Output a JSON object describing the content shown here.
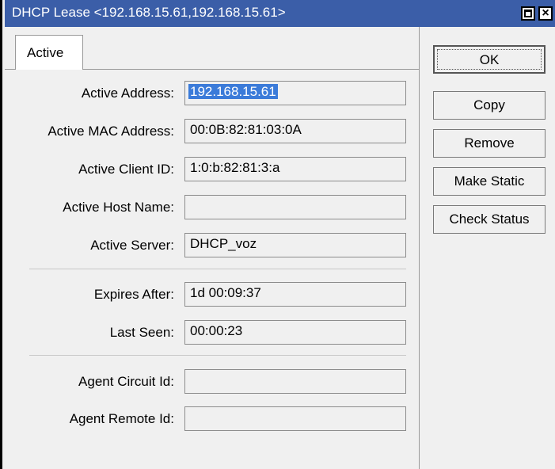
{
  "window": {
    "title": "DHCP Lease <192.168.15.61,192.168.15.61>",
    "close_glyph": "×"
  },
  "tabs": [
    {
      "label": "Active"
    }
  ],
  "fields": {
    "active_address": {
      "label": "Active Address:",
      "value": "192.168.15.61"
    },
    "active_mac_address": {
      "label": "Active MAC Address:",
      "value": "00:0B:82:81:03:0A"
    },
    "active_client_id": {
      "label": "Active Client ID:",
      "value": "1:0:b:82:81:3:a"
    },
    "active_host_name": {
      "label": "Active Host Name:",
      "value": ""
    },
    "active_server": {
      "label": "Active Server:",
      "value": "DHCP_voz"
    },
    "expires_after": {
      "label": "Expires After:",
      "value": "1d 00:09:37"
    },
    "last_seen": {
      "label": "Last Seen:",
      "value": "00:00:23"
    },
    "agent_circuit_id": {
      "label": "Agent Circuit Id:",
      "value": ""
    },
    "agent_remote_id": {
      "label": "Agent Remote Id:",
      "value": ""
    }
  },
  "buttons": {
    "ok": "OK",
    "copy": "Copy",
    "remove": "Remove",
    "make_static": "Make Static",
    "check_status": "Check Status"
  },
  "colors": {
    "titlebar": "#3b5ea8",
    "selection": "#3b7bd9"
  }
}
